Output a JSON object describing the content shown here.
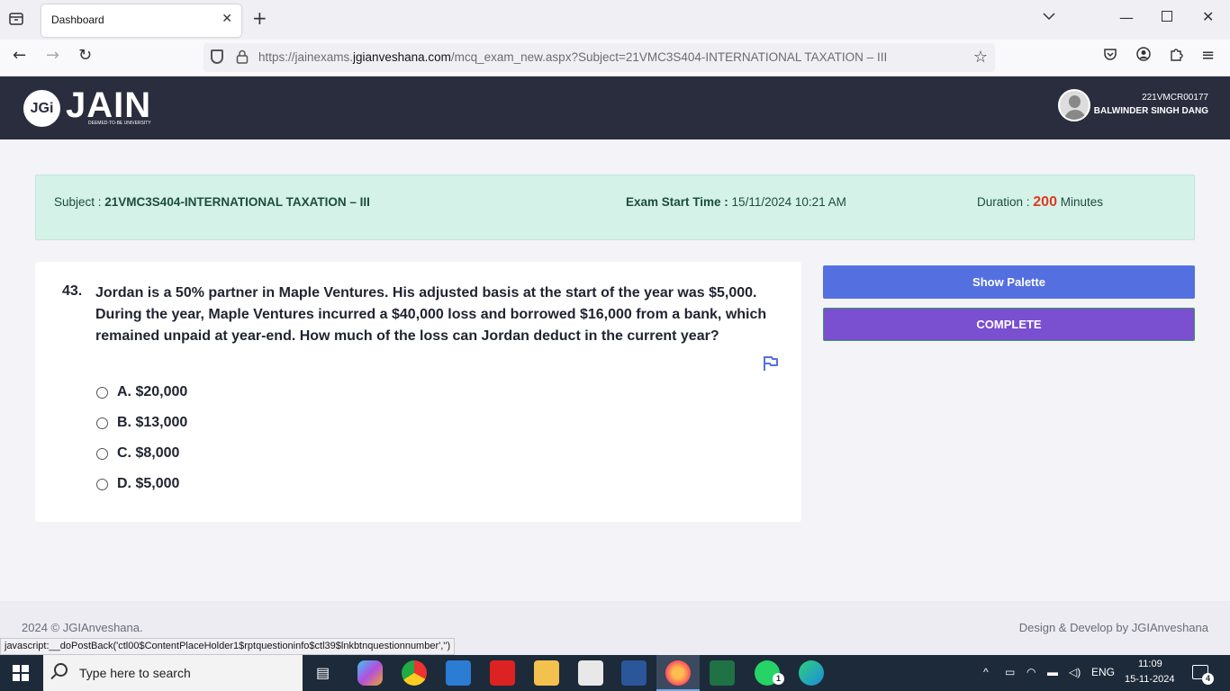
{
  "browser": {
    "tab_title": "Dashboard",
    "url_prefix": "https://jainexams.",
    "url_domain": "jgianveshana.com",
    "url_path": "/mcq_exam_new.aspx?Subject=21VMC3S404-INTERNATIONAL TAXATION – III"
  },
  "header": {
    "logo_badge": "JGi",
    "logo_word": "JAIN",
    "logo_sub": "DEEMED-TO-BE UNIVERSITY",
    "user_id": "221VMCR00177",
    "user_name": "BALWINDER SINGH DANG"
  },
  "exam": {
    "subject_label": "Subject : ",
    "subject_value": "21VMC3S404-INTERNATIONAL TAXATION – III",
    "start_label": "Exam Start Time : ",
    "start_value": "15/11/2024 10:21 AM",
    "duration_label": "Duration : ",
    "duration_value": "200",
    "duration_unit": " Minutes"
  },
  "question": {
    "number": "43.",
    "text": "Jordan is a 50% partner in Maple Ventures. His adjusted basis at the start of the year was $5,000. During the year, Maple Ventures incurred a $40,000 loss and borrowed $16,000 from a bank, which remained unpaid at year-end. How much of the loss can Jordan deduct in the current year?",
    "options": [
      {
        "label": "A. $20,000"
      },
      {
        "label": "B. $13,000"
      },
      {
        "label": "C. $8,000"
      },
      {
        "label": "D. $5,000"
      }
    ]
  },
  "actions": {
    "palette_label": "Show Palette",
    "complete_label": "COMPLETE"
  },
  "footer": {
    "copyright": "2024 © JGIAnveshana.",
    "credit": "Design & Develop by JGIAnveshana",
    "status_link": "javascript:__doPostBack('ctl00$ContentPlaceHolder1$rptquestioninfo$ctl39$lnkbtnquestionnumber','')"
  },
  "taskbar": {
    "search_placeholder": "Type here to search",
    "language": "ENG",
    "time": "11:09",
    "date": "15-11-2024",
    "notification_count": "4",
    "whatsapp_badge": "1"
  },
  "colors": {
    "header_bg": "#292d3e",
    "info_bg": "#d5f2e8",
    "palette_btn": "#5470e0",
    "complete_btn": "#7a4fd0",
    "duration_accent": "#e03a1e"
  }
}
